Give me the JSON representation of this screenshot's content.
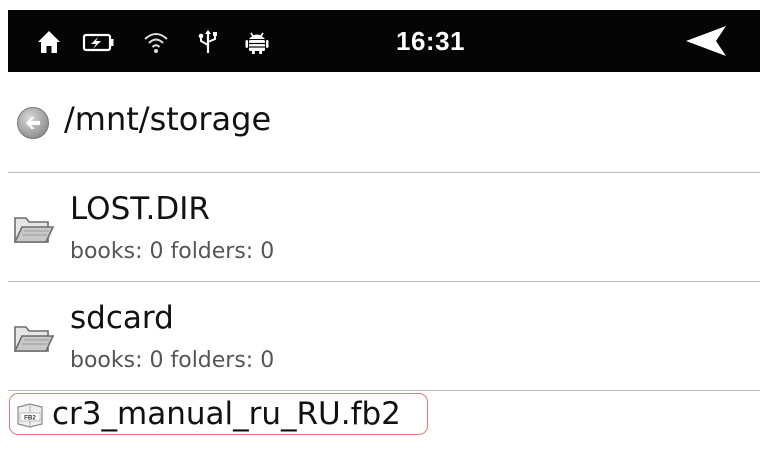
{
  "status_bar": {
    "time": "16:31",
    "icons": [
      "home-icon",
      "battery-charging-icon",
      "wifi-icon",
      "usb-icon",
      "android-icon"
    ],
    "background": "#050505"
  },
  "browser": {
    "current_path": "/mnt/storage",
    "items": [
      {
        "name": "LOST.DIR",
        "summary": "books: 0 folders: 0",
        "icon": "folder-icon"
      },
      {
        "name": "sdcard",
        "summary": "books: 0 folders: 0",
        "icon": "folder-icon"
      }
    ],
    "files": [
      {
        "name": "cr3_manual_ru_RU.fb2",
        "icon": "fb2-file-icon",
        "badge": "FB2",
        "highlighted": true
      }
    ]
  },
  "colors": {
    "highlight_border": "#e07a7a",
    "divider": "#bdbdbd"
  }
}
